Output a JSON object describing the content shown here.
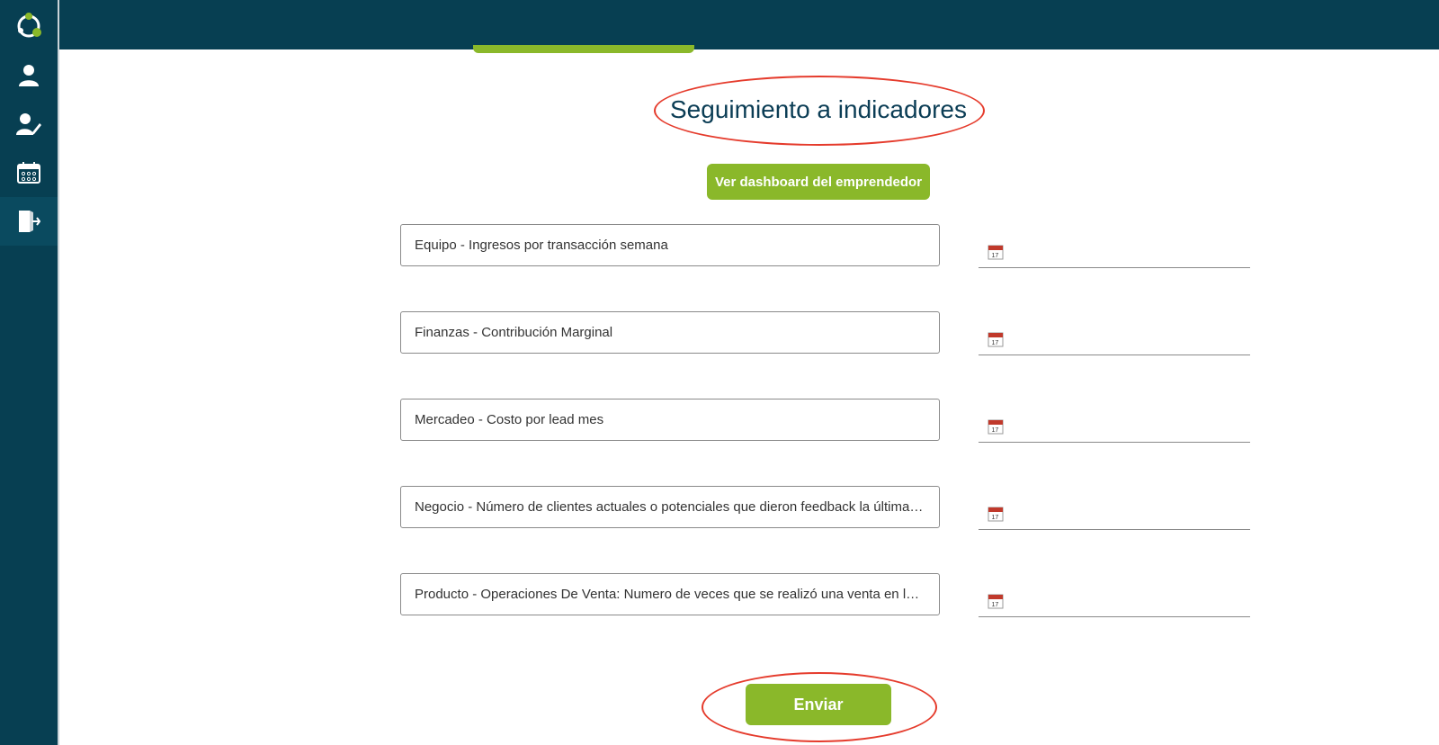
{
  "nav": {
    "icons": [
      "app-logo",
      "user-icon",
      "user-edit-icon",
      "calendar-icon",
      "exit-icon"
    ]
  },
  "page": {
    "title": "Seguimiento a indicadores",
    "dashboard_button": "Ver dashboard del emprendedor",
    "send_button": "Enviar"
  },
  "indicators": [
    {
      "value": "Equipo - Ingresos por transacción semana"
    },
    {
      "value": "Finanzas - Contribución Marginal"
    },
    {
      "value": "Mercadeo - Costo por lead mes"
    },
    {
      "value": "Negocio - Número de clientes actuales o potenciales que dieron feedback la última semana"
    },
    {
      "value": "Producto - Operaciones De Venta: Numero de veces que se realizó una venta en los últimos"
    }
  ],
  "colors": {
    "header": "#073f52",
    "accent_green": "#8ab82a",
    "title_text": "#0b3d55",
    "highlight_red": "#e53b2c"
  }
}
